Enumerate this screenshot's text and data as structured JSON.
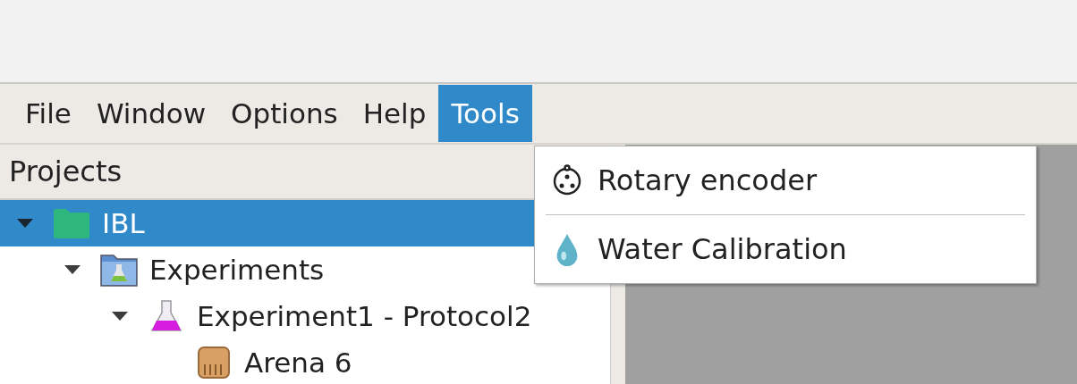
{
  "menu_bar": [
    {
      "label": "File",
      "selected": false
    },
    {
      "label": "Window",
      "selected": false
    },
    {
      "label": "Options",
      "selected": false
    },
    {
      "label": "Help",
      "selected": false
    },
    {
      "label": "Tools",
      "selected": true
    }
  ],
  "tools_menu": {
    "items": [
      {
        "label": "Rotary encoder",
        "kind": "encoder"
      },
      {
        "label": "Water Calibration",
        "kind": "water"
      }
    ]
  },
  "projects": {
    "title": "Projects",
    "tree": [
      {
        "label": "IBL",
        "kind": "project",
        "selected": true,
        "expanded": true,
        "children": [
          {
            "label": "Experiments",
            "kind": "experiments",
            "selected": false,
            "expanded": true,
            "children": [
              {
                "label": "Experiment1 - Protocol2",
                "kind": "experiment",
                "selected": false,
                "expanded": true,
                "children": [
                  {
                    "label": "Arena 6",
                    "kind": "arena",
                    "selected": false
                  }
                ]
              }
            ]
          }
        ]
      }
    ]
  }
}
